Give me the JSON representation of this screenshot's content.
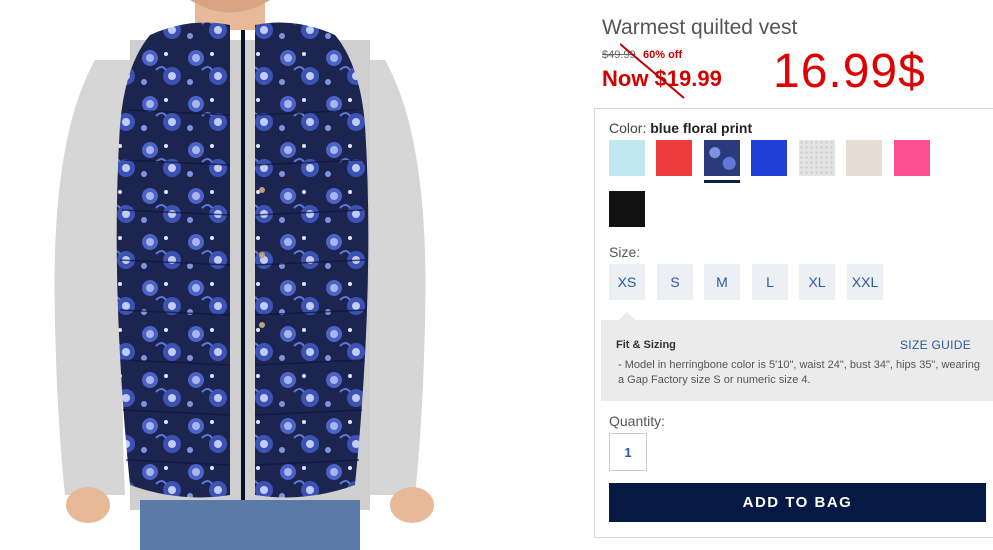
{
  "product": {
    "title": "Warmest quilted vest",
    "price_original": "$49.99",
    "price_discount": "60% off",
    "price_now": "Now $19.99",
    "handwritten_price": "16.99$"
  },
  "color": {
    "label": "Color:",
    "selected_name": "blue floral print",
    "swatches": [
      {
        "name": "light-aqua",
        "color": "#bfe8f0"
      },
      {
        "name": "coral-red",
        "color": "#ee3b3b"
      },
      {
        "name": "blue-floral-print",
        "color": "#2a3a7a",
        "selected": true
      },
      {
        "name": "royal-blue",
        "color": "#1f3fd6"
      },
      {
        "name": "light-grey-quilt",
        "color": "#e4e4e4"
      },
      {
        "name": "beige",
        "color": "#e6ded3"
      },
      {
        "name": "pink",
        "color": "#ff4f93"
      },
      {
        "name": "black",
        "color": "#111111"
      }
    ]
  },
  "size": {
    "label": "Size:",
    "options": [
      "XS",
      "S",
      "M",
      "L",
      "XL",
      "XXL"
    ]
  },
  "fit": {
    "title": "Fit & Sizing",
    "size_guide": "SIZE GUIDE",
    "text": "- Model in herringbone color is 5'10\", waist 24\", bust 34\", hips 35\", wearing a Gap Factory size S or numeric size 4."
  },
  "quantity": {
    "label": "Quantity:",
    "value": "1"
  },
  "actions": {
    "add_to_bag": "ADD TO BAG"
  }
}
